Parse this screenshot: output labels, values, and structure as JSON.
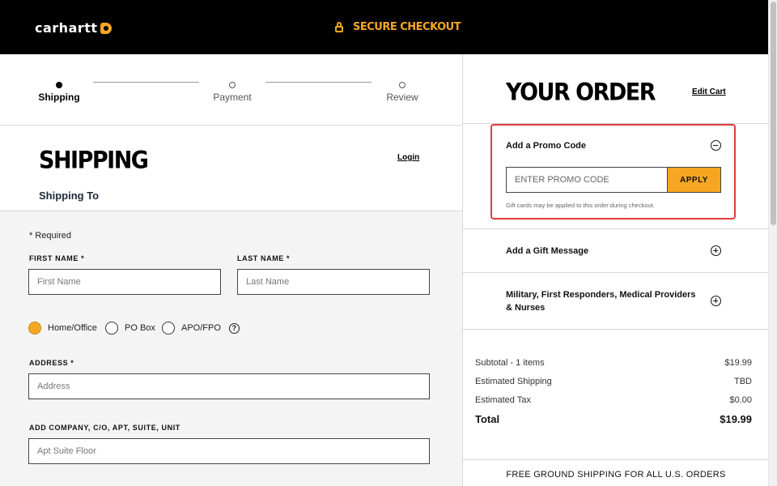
{
  "header": {
    "logo": "carhartt",
    "secure_label": "SECURE CHECKOUT"
  },
  "steps": [
    {
      "label": "Shipping",
      "active": true
    },
    {
      "label": "Payment",
      "active": false
    },
    {
      "label": "Review",
      "active": false
    }
  ],
  "shipping": {
    "title": "SHIPPING",
    "login": "Login",
    "shipping_to": "Shipping To",
    "required_note": "* Required",
    "first_name_label": "FIRST NAME *",
    "first_name_placeholder": "First Name",
    "last_name_label": "LAST NAME *",
    "last_name_placeholder": "Last Name",
    "address_types": [
      "Home/Office",
      "PO Box",
      "APO/FPO"
    ],
    "selected_address_type": "Home/Office",
    "help_glyph": "?",
    "address_label": "ADDRESS *",
    "address_placeholder": "Address",
    "company_label": "ADD COMPANY, C/O, APT, SUITE, UNIT",
    "company_placeholder": "Apt Suite Floor"
  },
  "order": {
    "title": "YOUR ORDER",
    "edit_cart": "Edit Cart",
    "promo_title": "Add a Promo Code",
    "promo_placeholder": "ENTER PROMO CODE",
    "apply_label": "APPLY",
    "gift_note": "Gift cards may be applied to this order during checkout.",
    "gift_message": "Add a Gift Message",
    "military_line1": "Military, First Responders, Medical Providers",
    "military_line2": "& Nurses",
    "summary": [
      {
        "label": "Subtotal - 1 items",
        "value": "$19.99"
      },
      {
        "label": "Estimated Shipping",
        "value": "TBD"
      },
      {
        "label": "Estimated Tax",
        "value": "$0.00"
      }
    ],
    "total_label": "Total",
    "total_value": "$19.99",
    "free_shipping": "FREE GROUND SHIPPING FOR ALL U.S. ORDERS"
  },
  "colors": {
    "accent": "#F5A623",
    "highlight": "#E23B3B",
    "header_bg": "#000000"
  }
}
